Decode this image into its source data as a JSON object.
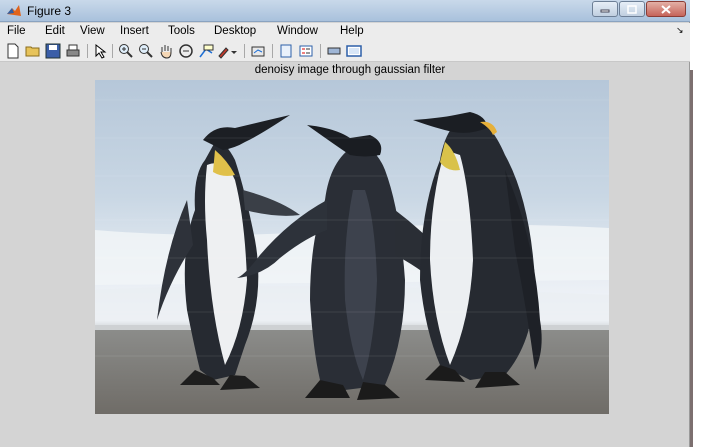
{
  "window": {
    "title": "Figure 3"
  },
  "menu": [
    "File",
    "Edit",
    "View",
    "Insert",
    "Tools",
    "Desktop",
    "Window",
    "Help"
  ],
  "toolbar": [
    "new-figure-icon",
    "open-file-icon",
    "save-icon",
    "print-icon",
    "edit-plot-arrow-icon",
    "zoom-in-icon",
    "zoom-out-icon",
    "pan-hand-icon",
    "rotate-3d-icon",
    "data-cursor-icon",
    "brush-icon",
    "brush-dropdown-icon",
    "link-plot-icon",
    "insert-colorbar-icon",
    "insert-legend-icon",
    "hide-plot-tools-icon",
    "show-plot-tools-icon"
  ],
  "axes": {
    "title": "denoisy image through gaussian filter"
  },
  "image": {
    "subject": "three-penguins-photo"
  }
}
